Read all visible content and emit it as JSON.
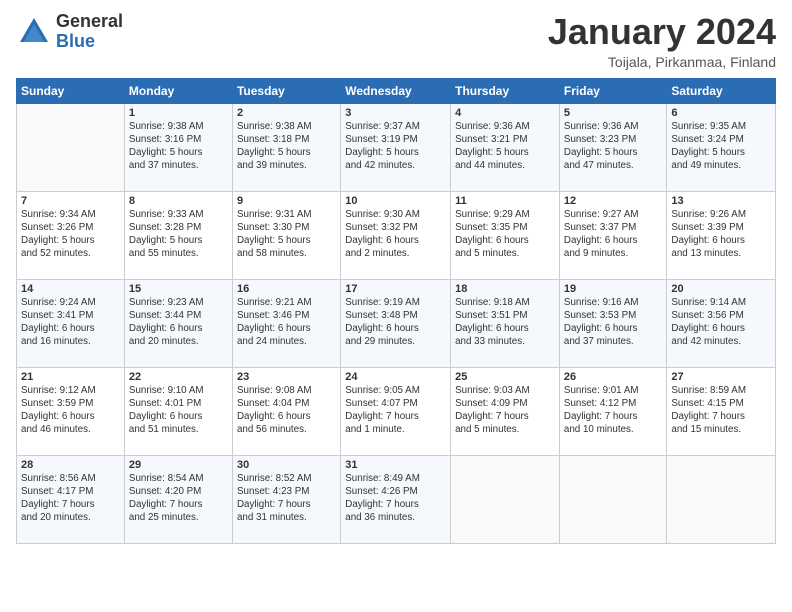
{
  "header": {
    "logo_general": "General",
    "logo_blue": "Blue",
    "main_title": "January 2024",
    "subtitle": "Toijala, Pirkanmaa, Finland"
  },
  "days_of_week": [
    "Sunday",
    "Monday",
    "Tuesday",
    "Wednesday",
    "Thursday",
    "Friday",
    "Saturday"
  ],
  "weeks": [
    [
      {
        "day": "",
        "info": ""
      },
      {
        "day": "1",
        "info": "Sunrise: 9:38 AM\nSunset: 3:16 PM\nDaylight: 5 hours\nand 37 minutes."
      },
      {
        "day": "2",
        "info": "Sunrise: 9:38 AM\nSunset: 3:18 PM\nDaylight: 5 hours\nand 39 minutes."
      },
      {
        "day": "3",
        "info": "Sunrise: 9:37 AM\nSunset: 3:19 PM\nDaylight: 5 hours\nand 42 minutes."
      },
      {
        "day": "4",
        "info": "Sunrise: 9:36 AM\nSunset: 3:21 PM\nDaylight: 5 hours\nand 44 minutes."
      },
      {
        "day": "5",
        "info": "Sunrise: 9:36 AM\nSunset: 3:23 PM\nDaylight: 5 hours\nand 47 minutes."
      },
      {
        "day": "6",
        "info": "Sunrise: 9:35 AM\nSunset: 3:24 PM\nDaylight: 5 hours\nand 49 minutes."
      }
    ],
    [
      {
        "day": "7",
        "info": "Sunrise: 9:34 AM\nSunset: 3:26 PM\nDaylight: 5 hours\nand 52 minutes."
      },
      {
        "day": "8",
        "info": "Sunrise: 9:33 AM\nSunset: 3:28 PM\nDaylight: 5 hours\nand 55 minutes."
      },
      {
        "day": "9",
        "info": "Sunrise: 9:31 AM\nSunset: 3:30 PM\nDaylight: 5 hours\nand 58 minutes."
      },
      {
        "day": "10",
        "info": "Sunrise: 9:30 AM\nSunset: 3:32 PM\nDaylight: 6 hours\nand 2 minutes."
      },
      {
        "day": "11",
        "info": "Sunrise: 9:29 AM\nSunset: 3:35 PM\nDaylight: 6 hours\nand 5 minutes."
      },
      {
        "day": "12",
        "info": "Sunrise: 9:27 AM\nSunset: 3:37 PM\nDaylight: 6 hours\nand 9 minutes."
      },
      {
        "day": "13",
        "info": "Sunrise: 9:26 AM\nSunset: 3:39 PM\nDaylight: 6 hours\nand 13 minutes."
      }
    ],
    [
      {
        "day": "14",
        "info": "Sunrise: 9:24 AM\nSunset: 3:41 PM\nDaylight: 6 hours\nand 16 minutes."
      },
      {
        "day": "15",
        "info": "Sunrise: 9:23 AM\nSunset: 3:44 PM\nDaylight: 6 hours\nand 20 minutes."
      },
      {
        "day": "16",
        "info": "Sunrise: 9:21 AM\nSunset: 3:46 PM\nDaylight: 6 hours\nand 24 minutes."
      },
      {
        "day": "17",
        "info": "Sunrise: 9:19 AM\nSunset: 3:48 PM\nDaylight: 6 hours\nand 29 minutes."
      },
      {
        "day": "18",
        "info": "Sunrise: 9:18 AM\nSunset: 3:51 PM\nDaylight: 6 hours\nand 33 minutes."
      },
      {
        "day": "19",
        "info": "Sunrise: 9:16 AM\nSunset: 3:53 PM\nDaylight: 6 hours\nand 37 minutes."
      },
      {
        "day": "20",
        "info": "Sunrise: 9:14 AM\nSunset: 3:56 PM\nDaylight: 6 hours\nand 42 minutes."
      }
    ],
    [
      {
        "day": "21",
        "info": "Sunrise: 9:12 AM\nSunset: 3:59 PM\nDaylight: 6 hours\nand 46 minutes."
      },
      {
        "day": "22",
        "info": "Sunrise: 9:10 AM\nSunset: 4:01 PM\nDaylight: 6 hours\nand 51 minutes."
      },
      {
        "day": "23",
        "info": "Sunrise: 9:08 AM\nSunset: 4:04 PM\nDaylight: 6 hours\nand 56 minutes."
      },
      {
        "day": "24",
        "info": "Sunrise: 9:05 AM\nSunset: 4:07 PM\nDaylight: 7 hours\nand 1 minute."
      },
      {
        "day": "25",
        "info": "Sunrise: 9:03 AM\nSunset: 4:09 PM\nDaylight: 7 hours\nand 5 minutes."
      },
      {
        "day": "26",
        "info": "Sunrise: 9:01 AM\nSunset: 4:12 PM\nDaylight: 7 hours\nand 10 minutes."
      },
      {
        "day": "27",
        "info": "Sunrise: 8:59 AM\nSunset: 4:15 PM\nDaylight: 7 hours\nand 15 minutes."
      }
    ],
    [
      {
        "day": "28",
        "info": "Sunrise: 8:56 AM\nSunset: 4:17 PM\nDaylight: 7 hours\nand 20 minutes."
      },
      {
        "day": "29",
        "info": "Sunrise: 8:54 AM\nSunset: 4:20 PM\nDaylight: 7 hours\nand 25 minutes."
      },
      {
        "day": "30",
        "info": "Sunrise: 8:52 AM\nSunset: 4:23 PM\nDaylight: 7 hours\nand 31 minutes."
      },
      {
        "day": "31",
        "info": "Sunrise: 8:49 AM\nSunset: 4:26 PM\nDaylight: 7 hours\nand 36 minutes."
      },
      {
        "day": "",
        "info": ""
      },
      {
        "day": "",
        "info": ""
      },
      {
        "day": "",
        "info": ""
      }
    ]
  ]
}
